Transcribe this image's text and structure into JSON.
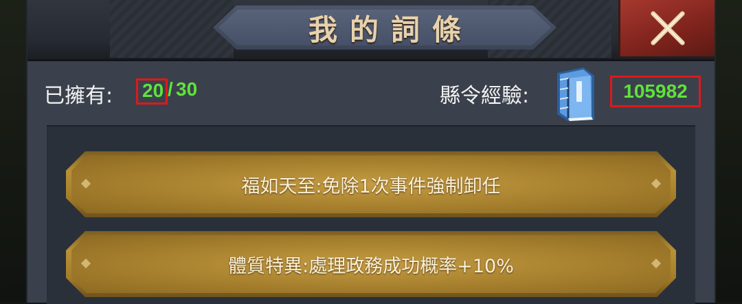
{
  "header": {
    "title": "我的詞條",
    "close_icon": "close-icon"
  },
  "stats": {
    "owned_label": "已擁有:",
    "owned_current": "20",
    "owned_separator": "/",
    "owned_max": "30",
    "exp_label": "縣令經驗:",
    "exp_icon": "book-icon",
    "exp_value": "105982"
  },
  "traits": [
    {
      "text": "福如天至:免除1次事件強制卸任"
    },
    {
      "text": "體質特異:處理政務成功概率+10%"
    }
  ],
  "colors": {
    "value_green": "#5fe33a",
    "highlight_red": "#e01818",
    "card_gold": "#b89137",
    "close_red": "#a6382f"
  }
}
